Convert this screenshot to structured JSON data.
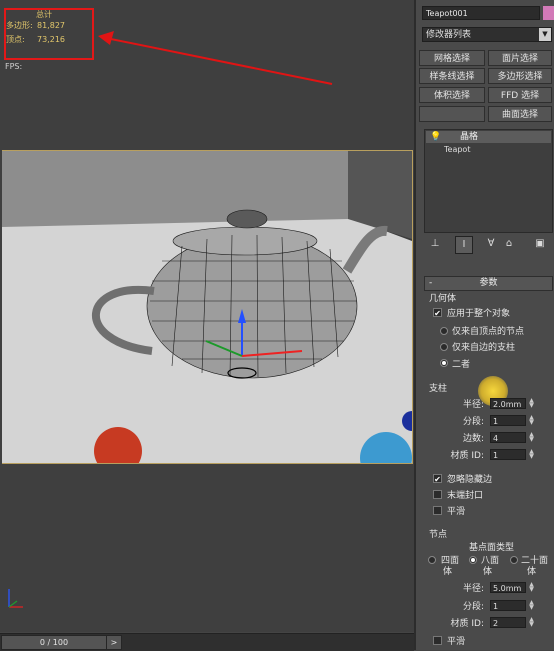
{
  "viewport": {
    "stats": {
      "total_label": "总计",
      "poly_label": "多边形:",
      "poly_value": "81,827",
      "vert_label": "顶点:",
      "vert_value": "73,216"
    },
    "fps_label": "FPS:",
    "timeline": {
      "frame_label": "0 / 100",
      "next_label": ">"
    }
  },
  "panel": {
    "object_name": "Teapot001",
    "swatch_color": "#d27ab8",
    "modifier_list": "修改器列表",
    "buttons": {
      "mesh_select": "网格选择",
      "patch_select": "面片选择",
      "spline_select": "样条线选择",
      "poly_select": "多边形选择",
      "vol_select": "体积选择",
      "ffd_select": "FFD 选择",
      "surface_select": "曲面选择"
    },
    "stack": {
      "header": "晶格",
      "item": "Teapot"
    },
    "rollout_title": "参数",
    "geometry": {
      "label": "几何体",
      "apply_whole": "应用于整个对象",
      "from_verts": "仅来自顶点的节点",
      "from_edges": "仅来自边的支柱",
      "both": "二者"
    },
    "struts": {
      "label": "支柱",
      "radius_label": "半径:",
      "radius_value": "2.0mm",
      "segments_label": "分段:",
      "segments_value": "1",
      "sides_label": "边数:",
      "sides_value": "4",
      "matid_label": "材质 ID:",
      "matid_value": "1",
      "ignore_hidden": "忽略隐藏边",
      "end_caps": "末端封口",
      "smooth": "平滑"
    },
    "joints": {
      "label": "节点",
      "base_type": "基点面类型",
      "tetra": "四面",
      "tetra2": "体",
      "octa": "八面",
      "octa2": "体",
      "icosa": "二十面",
      "icosa2": "体",
      "radius_label": "半径:",
      "radius_value": "5.0mm",
      "segments_label": "分段:",
      "segments_value": "1",
      "matid_label": "材质 ID:",
      "matid_value": "2",
      "smooth": "平滑"
    }
  }
}
